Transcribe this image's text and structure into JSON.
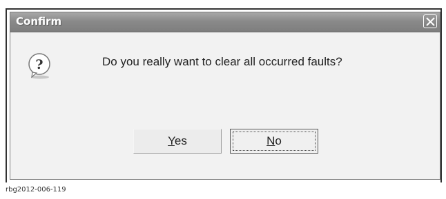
{
  "dialog": {
    "title": "Confirm",
    "message": "Do you really want to clear all occurred faults?",
    "icon": "question-icon",
    "buttons": {
      "yes_mnemonic": "Y",
      "yes_rest": "es",
      "no_mnemonic": "N",
      "no_rest": "o"
    }
  },
  "caption": "rbg2012-006-119",
  "colors": {
    "titlebar": "#8a8a8a",
    "dialog_bg": "#f2f2f2"
  }
}
